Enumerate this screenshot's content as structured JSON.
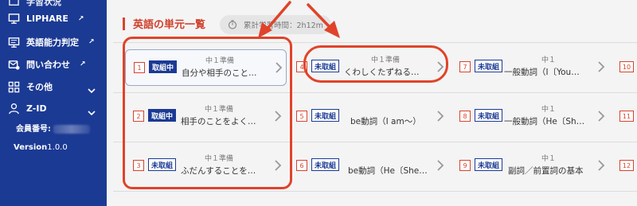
{
  "sidebar": {
    "top_label": "学習状況",
    "items": [
      {
        "label": "LIPHARE",
        "icon": "monitor-icon"
      },
      {
        "label": "英語能力判定",
        "icon": "monitor-icon"
      },
      {
        "label": "問い合わせ",
        "icon": "mail-icon"
      },
      {
        "label": "その他",
        "icon": "grid-icon"
      },
      {
        "label": "Z-ID",
        "icon": "user-icon"
      }
    ],
    "member_label": "会員番号:",
    "version_label": "Version",
    "version_value": "1.0.0"
  },
  "main": {
    "title": "英語の単元一覧",
    "timer_label": "累計学習時間：2h12m"
  },
  "units": [
    {
      "num": "1",
      "status": "取組中",
      "level": "中１準備",
      "name": "自分や相手のこと…"
    },
    {
      "num": "2",
      "status": "取組中",
      "level": "中１準備",
      "name": "相手のことをよく…"
    },
    {
      "num": "3",
      "status": "未取組",
      "level": "中１準備",
      "name": "ふだんすることを…"
    },
    {
      "num": "4",
      "status": "未取組",
      "level": "中１準備",
      "name": "くわしくたずねる…"
    },
    {
      "num": "5",
      "status": "未取組",
      "level": "中１",
      "name": "be動詞（I am〜）"
    },
    {
      "num": "6",
      "status": "未取組",
      "level": "中１",
      "name": "be動詞（He〔She…"
    },
    {
      "num": "7",
      "status": "未取組",
      "level": "中１",
      "name": "一般動詞（I〔You…"
    },
    {
      "num": "8",
      "status": "未取組",
      "level": "中１",
      "name": "一般動詞（He〔Sh…"
    },
    {
      "num": "9",
      "status": "未取組",
      "level": "中１",
      "name": "副詞／前置詞の基本"
    },
    {
      "num": "10",
      "status": "",
      "level": "",
      "name": ""
    },
    {
      "num": "11",
      "status": "",
      "level": "",
      "name": ""
    },
    {
      "num": "12",
      "status": "",
      "level": "",
      "name": ""
    }
  ],
  "colors": {
    "sidebar_bg": "#1b3a94",
    "accent_red": "#d8432f",
    "badge_blue": "#1b3a94",
    "annotation_red": "#e0432a"
  }
}
